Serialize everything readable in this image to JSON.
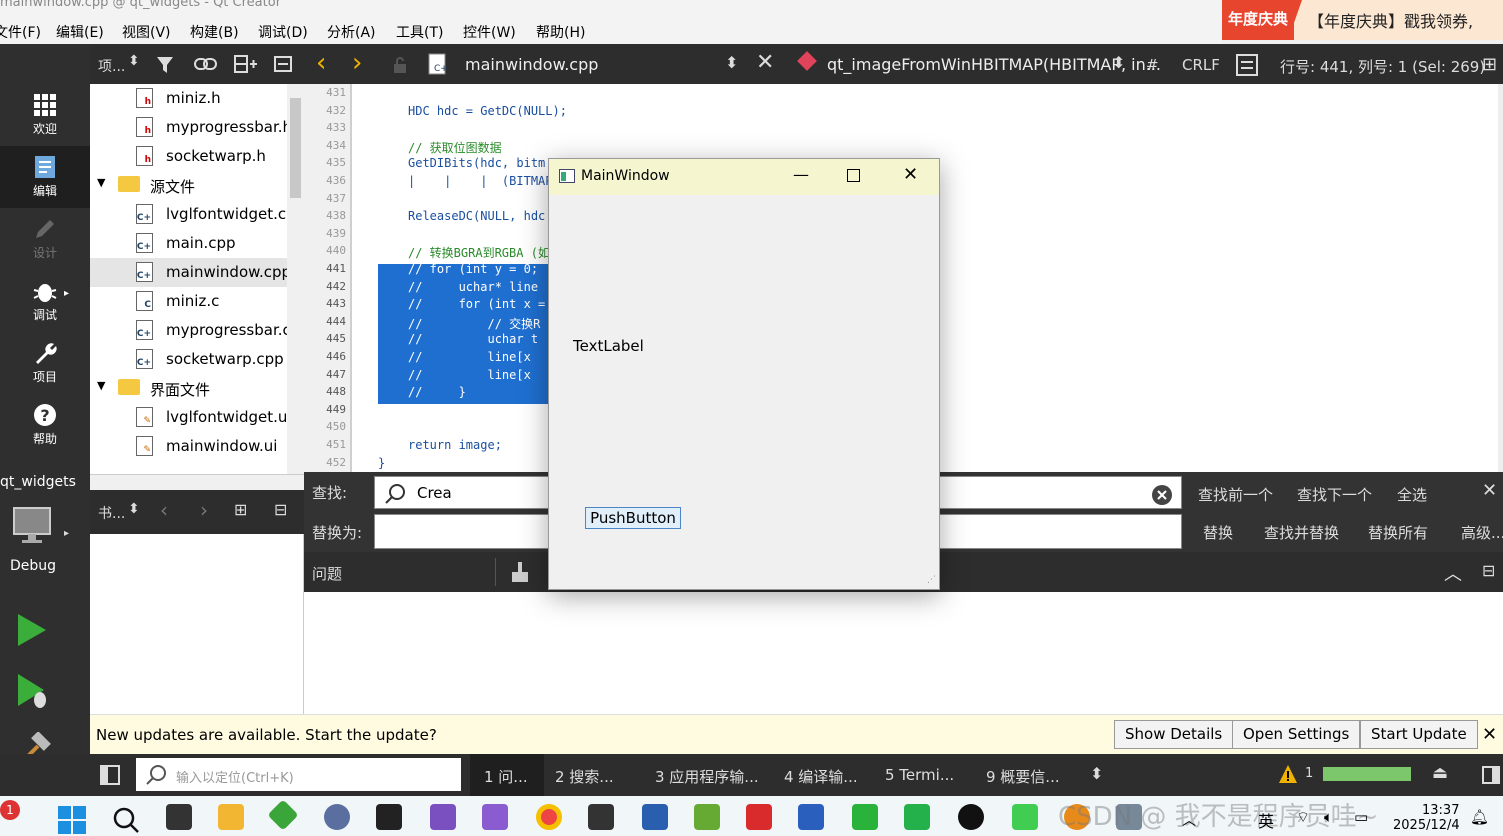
{
  "window": {
    "title": "mainwindow.cpp @ qt_widgets - Qt Creator"
  },
  "ad": {
    "tag": "年度庆典",
    "text": "【年度庆典】戳我领券,"
  },
  "menu": [
    "文件(F)",
    "编辑(E)",
    "视图(V)",
    "构建(B)",
    "调试(D)",
    "分析(A)",
    "工具(T)",
    "控件(W)",
    "帮助(H)"
  ],
  "modes": [
    {
      "label": "欢迎",
      "icon": "grid-icon"
    },
    {
      "label": "编辑",
      "icon": "edit-doc-icon"
    },
    {
      "label": "设计",
      "icon": "pencil-icon"
    },
    {
      "label": "调试",
      "icon": "bug-icon"
    },
    {
      "label": "项目",
      "icon": "wrench-icon"
    },
    {
      "label": "帮助",
      "icon": "question-icon"
    }
  ],
  "kit": {
    "project": "qt_widgets",
    "config": "Debug"
  },
  "projectToolbar": {
    "label": "项..."
  },
  "bookmarkToolbar": {
    "label": "书..."
  },
  "tree": [
    {
      "label": "miniz.h",
      "type": "h",
      "level": 1
    },
    {
      "label": "myprogressbar.h",
      "type": "h",
      "level": 1
    },
    {
      "label": "socketwarp.h",
      "type": "h",
      "level": 1
    },
    {
      "label": "源文件",
      "type": "folder",
      "level": 0
    },
    {
      "label": "lvglfontwidget.cp",
      "type": "cpp",
      "level": 1
    },
    {
      "label": "main.cpp",
      "type": "cpp",
      "level": 1
    },
    {
      "label": "mainwindow.cpp",
      "type": "cpp",
      "level": 1,
      "selected": true
    },
    {
      "label": "miniz.c",
      "type": "c",
      "level": 1
    },
    {
      "label": "myprogressbar.cp",
      "type": "cpp",
      "level": 1
    },
    {
      "label": "socketwarp.cpp",
      "type": "cpp",
      "level": 1
    },
    {
      "label": "界面文件",
      "type": "folder",
      "level": 0
    },
    {
      "label": "lvglfontwidget.ui",
      "type": "ui",
      "level": 1
    },
    {
      "label": "mainwindow.ui",
      "type": "ui",
      "level": 1
    }
  ],
  "editor": {
    "file": "mainwindow.cpp",
    "symbol": "qt_imageFromWinHBITMAP(HBITMAP, in...",
    "hash": "#",
    "lineEnding": "CRLF",
    "position": "行号: 441, 列号: 1 (Sel: 269)"
  },
  "code": [
    {
      "n": "431",
      "t": ""
    },
    {
      "n": "432",
      "t": "HDC hdc = GetDC(NULL);"
    },
    {
      "n": "433",
      "t": ""
    },
    {
      "n": "434",
      "t": "// 获取位图数据"
    },
    {
      "n": "435",
      "t": "GetDIBits(hdc, bitm"
    },
    {
      "n": "436",
      "t": "|    |    |  (BITMAPIN"
    },
    {
      "n": "437",
      "t": ""
    },
    {
      "n": "438",
      "t": "ReleaseDC(NULL, hdc"
    },
    {
      "n": "439",
      "t": ""
    },
    {
      "n": "440",
      "t": "// 转换BGRA到RGBA (如"
    },
    {
      "n": "441",
      "t": "// for (int y = 0;"
    },
    {
      "n": "442",
      "t": "//     uchar* line"
    },
    {
      "n": "443",
      "t": "//     for (int x ="
    },
    {
      "n": "444",
      "t": "//         // 交换R"
    },
    {
      "n": "445",
      "t": "//         uchar t"
    },
    {
      "n": "446",
      "t": "//         line[x"
    },
    {
      "n": "447",
      "t": "//         line[x"
    },
    {
      "n": "448",
      "t": "//     }"
    },
    {
      "n": "449",
      "t": "// }"
    },
    {
      "n": "450",
      "t": ""
    },
    {
      "n": "451",
      "t": "return image;"
    },
    {
      "n": "452",
      "t": "}"
    }
  ],
  "find": {
    "findLabel": "查找:",
    "replaceLabel": "替换为:",
    "findValue": "Crea",
    "prev": "查找前一个",
    "next": "查找下一个",
    "selectAll": "全选",
    "replace": "替换",
    "findReplace": "查找并替换",
    "replaceAll": "替换所有",
    "advanced": "高级..."
  },
  "issues": {
    "label": "问题"
  },
  "mainwindow": {
    "title": "MainWindow",
    "label": "TextLabel",
    "button": "PushButton"
  },
  "notification": {
    "text": "New updates are available. Start the update?",
    "showDetails": "Show Details",
    "openSettings": "Open Settings",
    "startUpdate": "Start Update"
  },
  "statusbar": {
    "locator": "输入以定位(Ctrl+K)",
    "tabs": [
      "1  问...",
      "2  搜索...",
      "3  应用程序输...",
      "4  编译输...",
      "5  Termi...",
      "9  概要信..."
    ],
    "warnings": "1"
  },
  "taskbar": {
    "badge": "1",
    "lang": "英",
    "time": "13:37",
    "date": "2025/12/4",
    "watermark": "CSDN @ 我不是程序员哇~"
  }
}
